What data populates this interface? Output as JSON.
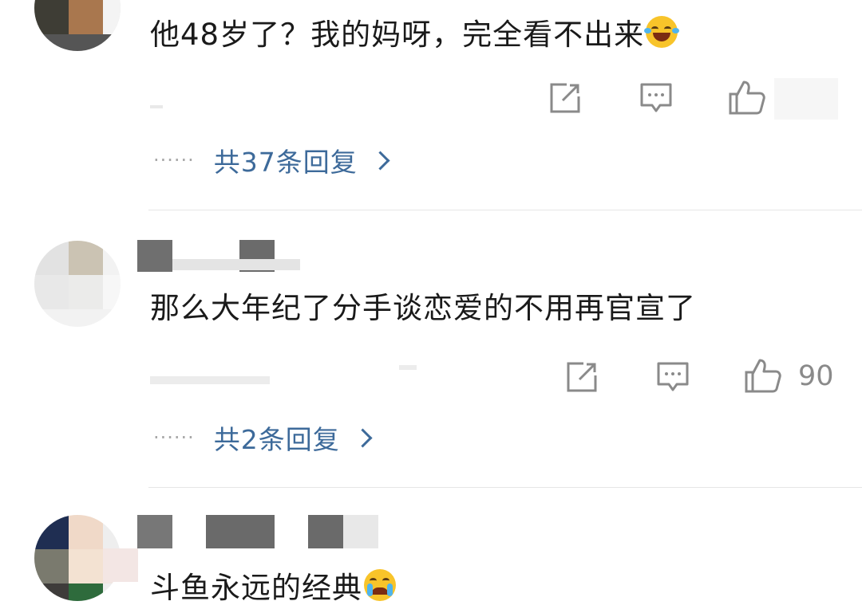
{
  "comments": [
    {
      "text": "他48岁了？我的妈呀，完全看不出来",
      "emoji": "laughing-tears-emoji",
      "replies_label": "共37条回复"
    },
    {
      "text": "那么大年纪了分手谈恋爱的不用再官宣了",
      "likes": "90",
      "replies_label": "共2条回复"
    },
    {
      "text": "斗鱼永远的经典",
      "emoji": "crying-emoji"
    }
  ],
  "ui": {
    "ellipsis": "······",
    "icons": [
      "share-icon",
      "comment-icon",
      "like-icon",
      "chevron-right-icon"
    ],
    "colors": {
      "link": "#3d6a9a",
      "muted": "#8a8a8a",
      "divider": "#e6e6e6"
    }
  }
}
